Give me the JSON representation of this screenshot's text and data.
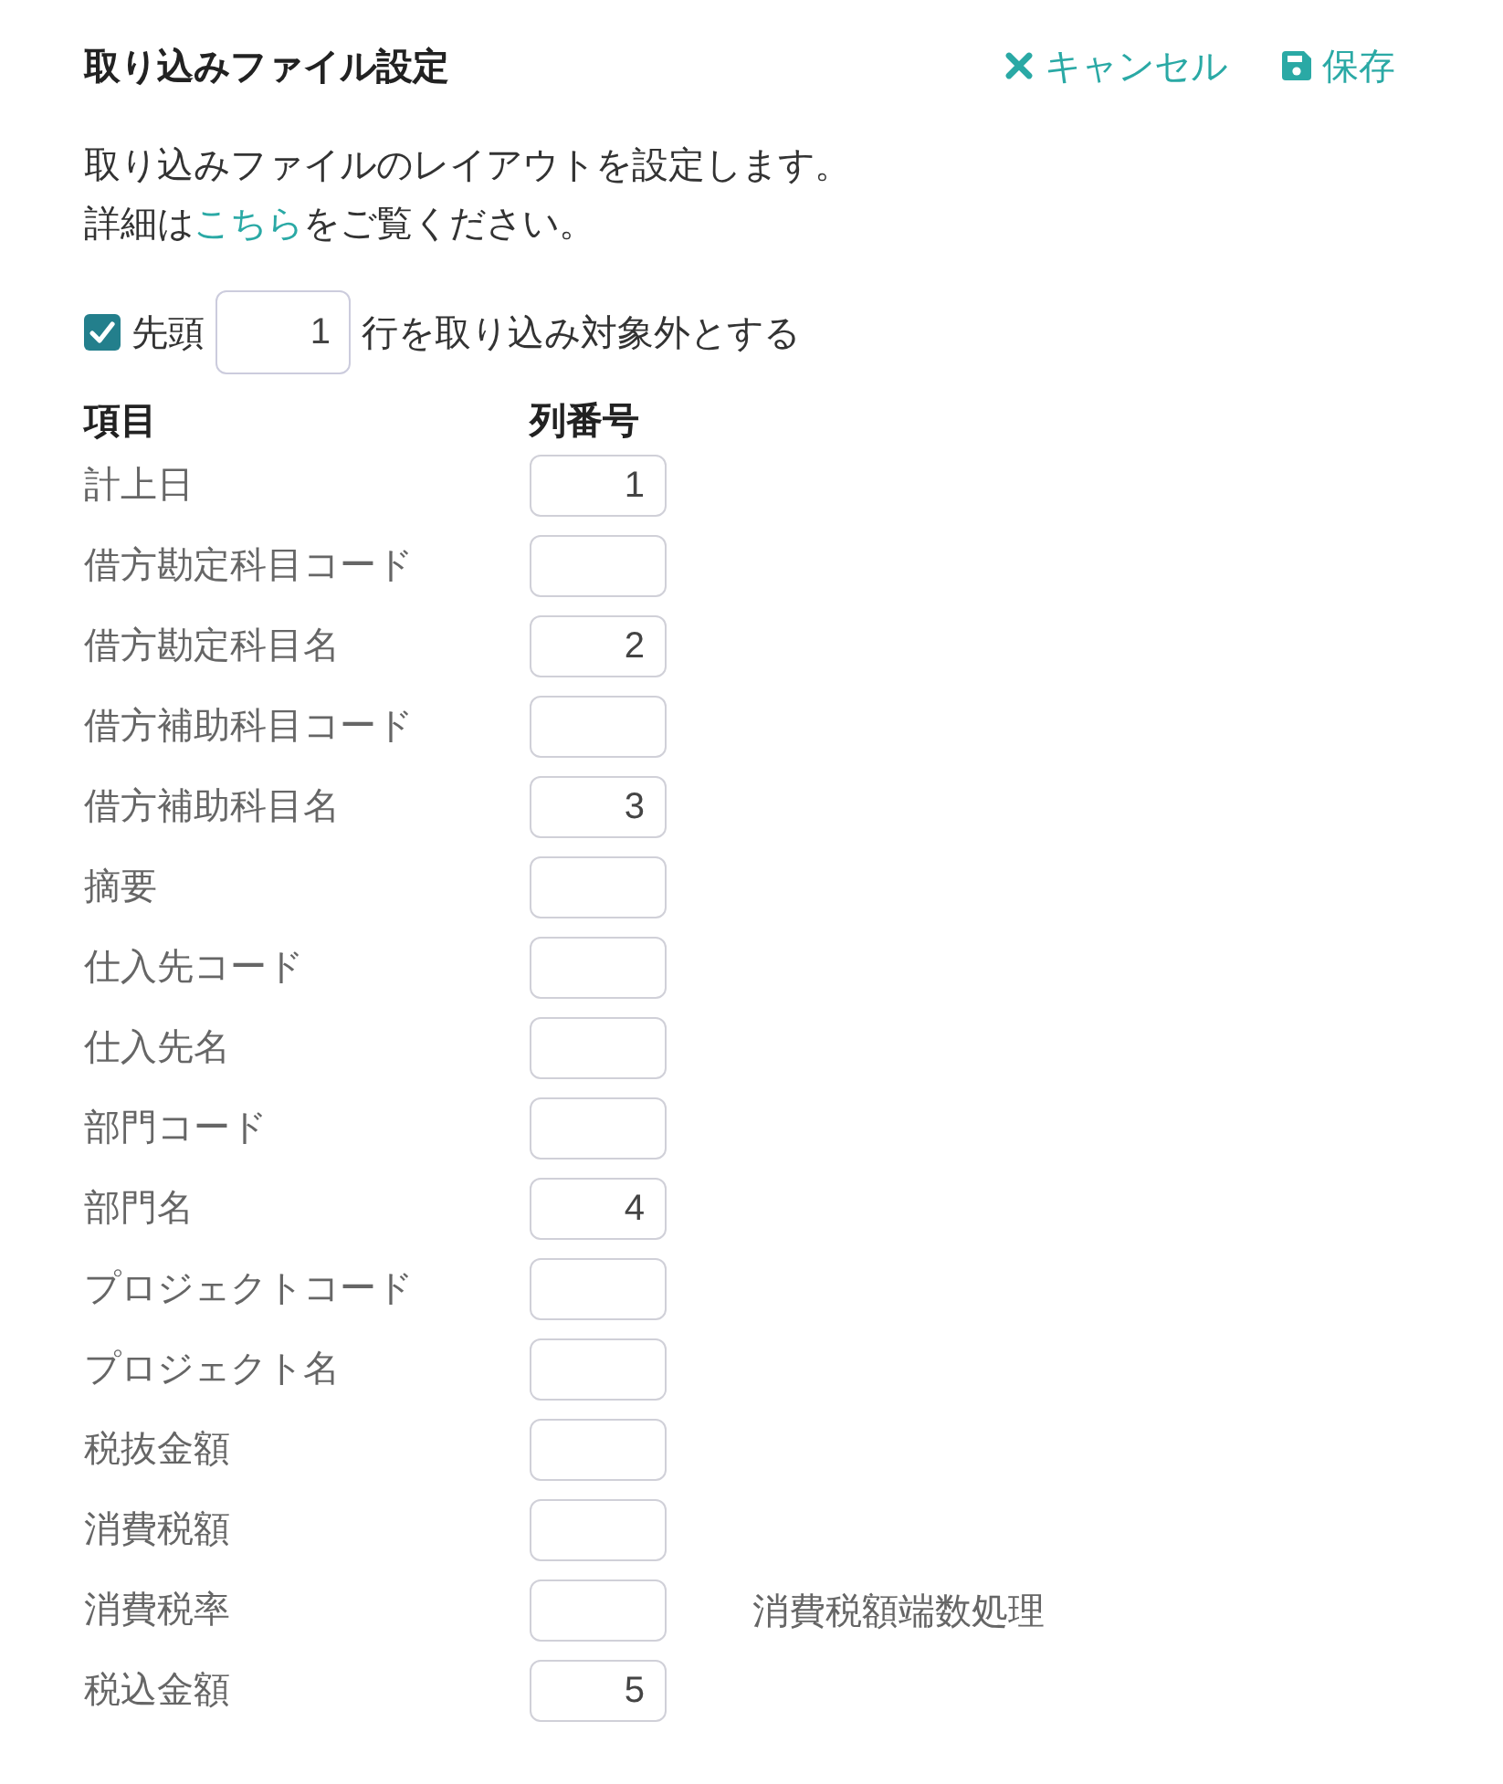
{
  "header": {
    "title": "取り込みファイル設定",
    "actions": [
      {
        "kind": "cancel",
        "label": "キャンセル"
      },
      {
        "kind": "save",
        "label": "保存"
      }
    ]
  },
  "description": {
    "line_1": "取り込みファイルのレイアウトを設定します。",
    "line_2": {
      "before": "詳細は",
      "link": "こちら",
      "after": "をご覧ください。"
    }
  },
  "skip_rows": {
    "checked": true,
    "before": "先頭",
    "value": "1",
    "after": "行を取り込み対象外とする"
  },
  "table": {
    "columns": [
      "項目",
      "列番号"
    ],
    "rows": [
      {
        "label": "計上日",
        "value": "1"
      },
      {
        "label": "借方勘定科目コード"
      },
      {
        "label": "借方勘定科目名",
        "value": "2"
      },
      {
        "label": "借方補助科目コード"
      },
      {
        "label": "借方補助科目名",
        "value": "3"
      },
      {
        "label": "摘要"
      },
      {
        "label": "仕入先コード"
      },
      {
        "label": "仕入先名"
      },
      {
        "label": "部門コード"
      },
      {
        "label": "部門名",
        "value": "4"
      },
      {
        "label": "プロジェクトコード"
      },
      {
        "label": "プロジェクト名"
      },
      {
        "label": "税抜金額"
      },
      {
        "label": "消費税額"
      },
      {
        "label": "消費税率",
        "note": "消費税額端数処理"
      },
      {
        "label": "税込金額",
        "value": "5"
      }
    ]
  }
}
